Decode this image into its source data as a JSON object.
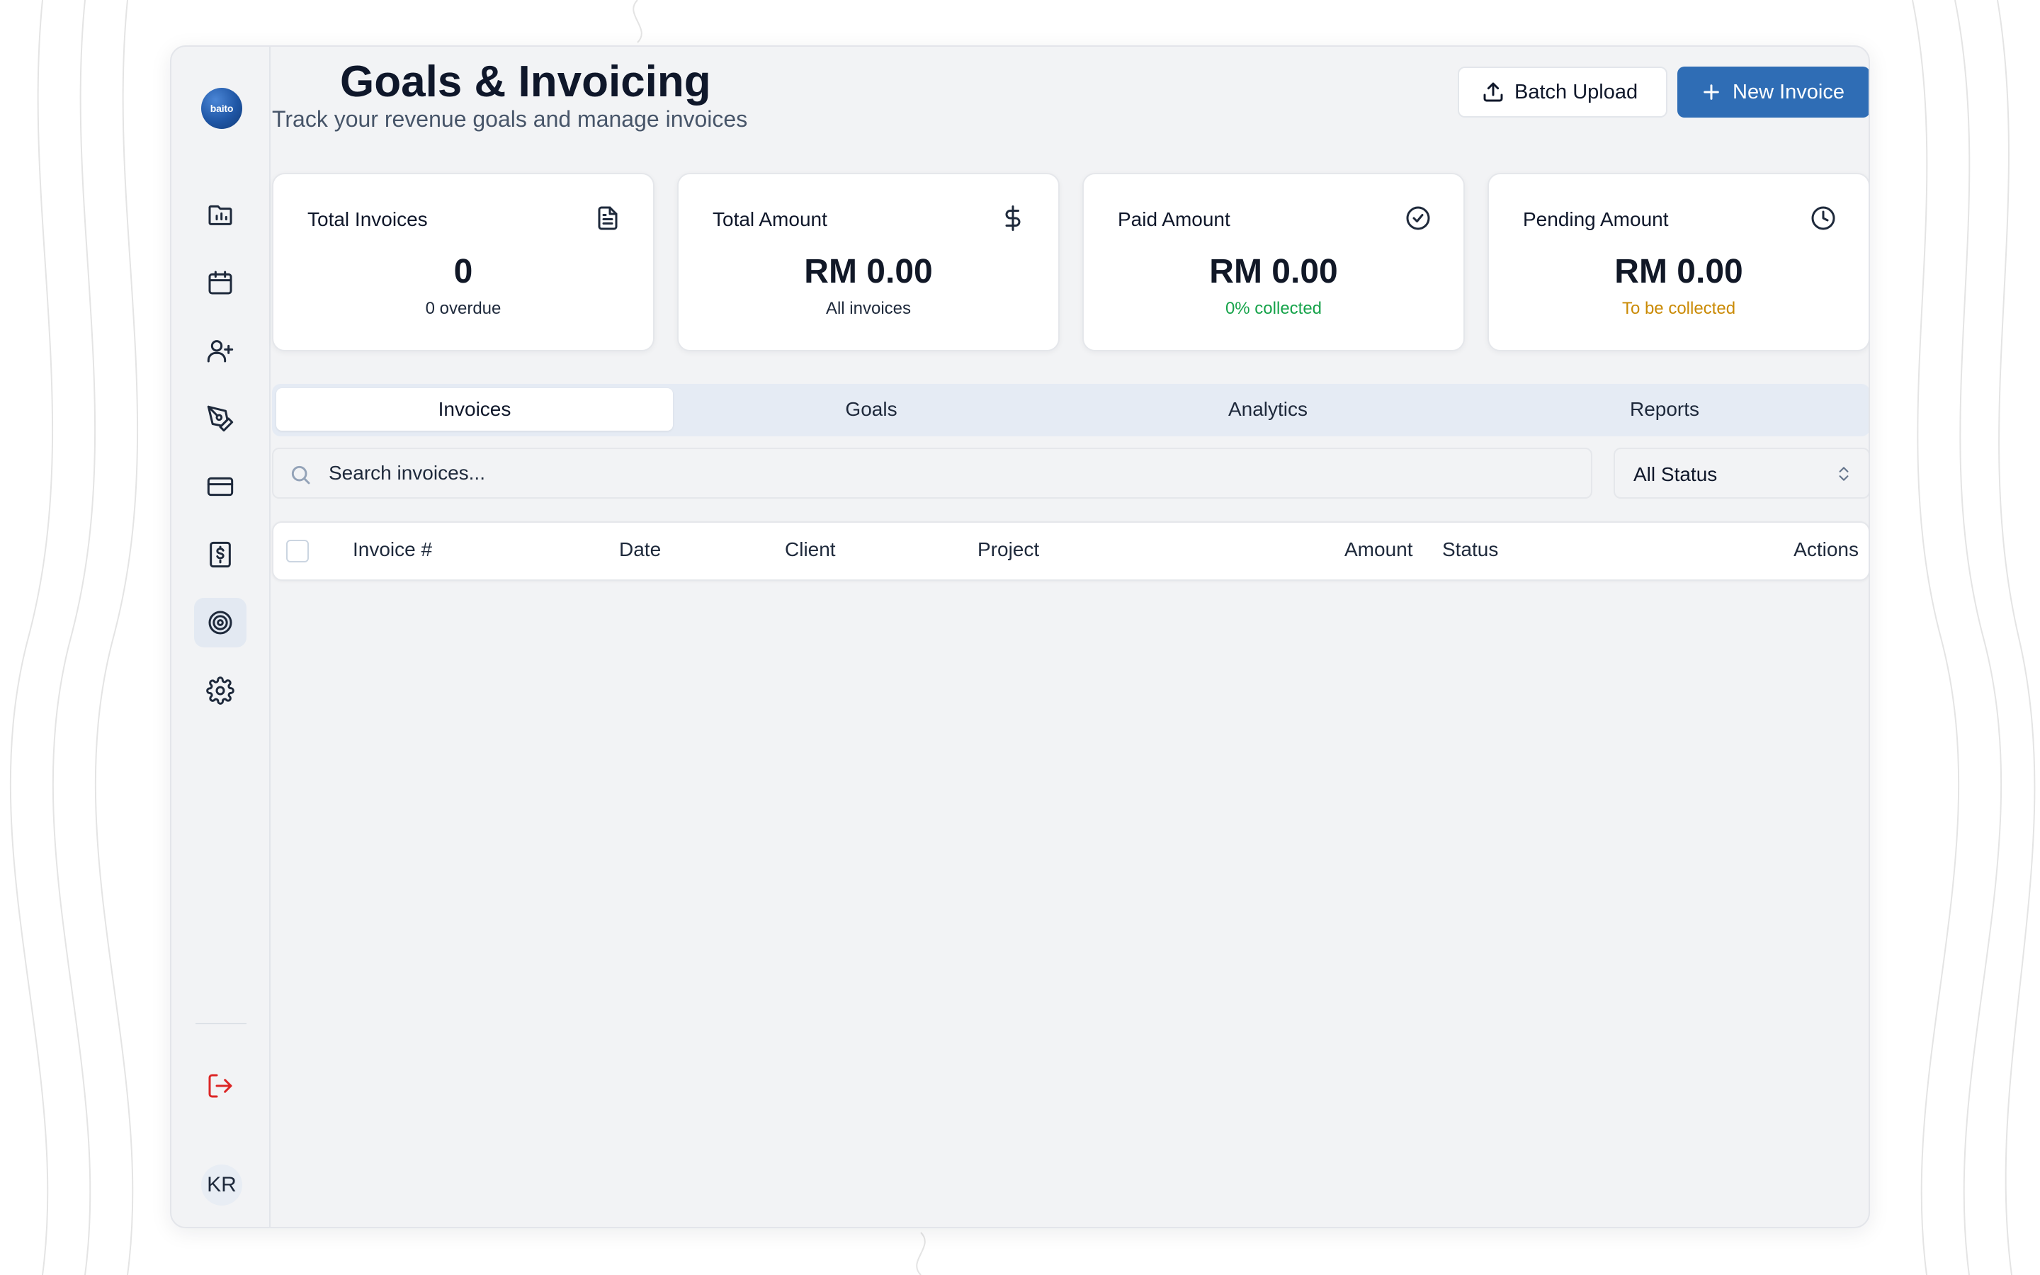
{
  "page": {
    "title": "Goals & Invoicing",
    "subtitle": "Track your revenue goals and manage invoices"
  },
  "sidebar": {
    "logo_text": "baito",
    "items": [
      {
        "icon": "folder-chart-icon",
        "active": false
      },
      {
        "icon": "calendar-icon",
        "active": false
      },
      {
        "icon": "user-plus-icon",
        "active": false
      },
      {
        "icon": "pen-tool-icon",
        "active": false
      },
      {
        "icon": "credit-card-icon",
        "active": false
      },
      {
        "icon": "receipt-dollar-icon",
        "active": false
      },
      {
        "icon": "target-icon",
        "active": true
      },
      {
        "icon": "gear-icon",
        "active": false
      }
    ],
    "avatar_initials": "KR"
  },
  "actions": {
    "batch_upload_label": "Batch Upload",
    "new_invoice_label": "New Invoice"
  },
  "stats": [
    {
      "label": "Total Invoices",
      "value": "0",
      "sub": "0 overdue",
      "icon": "file-text-icon"
    },
    {
      "label": "Total Amount",
      "value": "RM 0.00",
      "sub": "All invoices",
      "icon": "dollar-icon"
    },
    {
      "label": "Paid Amount",
      "value": "RM 0.00",
      "sub": "0% collected",
      "icon": "check-circle-icon"
    },
    {
      "label": "Pending Amount",
      "value": "RM 0.00",
      "sub": "To be collected",
      "icon": "clock-icon"
    }
  ],
  "tabs": [
    "Invoices",
    "Goals",
    "Analytics",
    "Reports"
  ],
  "active_tab": "Invoices",
  "search": {
    "placeholder": "Search invoices...",
    "value": ""
  },
  "status_filter": {
    "selected": "All Status"
  },
  "table": {
    "columns": [
      "Invoice #",
      "Date",
      "Client",
      "Project",
      "Amount",
      "Status",
      "Actions"
    ],
    "rows": []
  },
  "colors": {
    "primary": "#2f6db5",
    "success": "#16a34a",
    "warning": "#ca8a04",
    "danger": "#dc2626"
  }
}
